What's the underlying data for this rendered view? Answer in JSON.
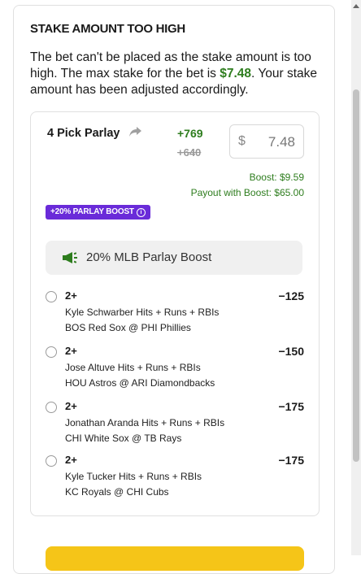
{
  "alert": {
    "title": "STAKE AMOUNT TOO HIGH",
    "message_before": "The bet can't be placed as the stake amount is too high. The max stake for the bet is ",
    "max_stake": "$7.48",
    "message_after": ". Your stake amount has been adjusted accordingly."
  },
  "bet": {
    "title": "4 Pick Parlay",
    "odds_boosted": "+769",
    "odds_original": "+640",
    "stake_currency": "$",
    "stake_value": "7.48",
    "boost_amount": "Boost: $9.59",
    "payout": "Payout with Boost: $65.00",
    "badge": "+20% PARLAY BOOST",
    "promo": "20% MLB Parlay Boost"
  },
  "legs": [
    {
      "line": "2+",
      "odds": "−125",
      "player": "Kyle Schwarber Hits + Runs + RBIs",
      "game": "BOS Red Sox @ PHI Phillies"
    },
    {
      "line": "2+",
      "odds": "−150",
      "player": "Jose Altuve Hits + Runs + RBIs",
      "game": "HOU Astros @ ARI Diamondbacks"
    },
    {
      "line": "2+",
      "odds": "−175",
      "player": "Jonathan Aranda Hits + Runs + RBIs",
      "game": "CHI White Sox @ TB Rays"
    },
    {
      "line": "2+",
      "odds": "−175",
      "player": "Kyle Tucker Hits + Runs + RBIs",
      "game": "KC Royals @ CHI Cubs"
    }
  ],
  "colors": {
    "accent_green": "#2e7d1e",
    "badge_purple": "#6a2bd9",
    "button_yellow": "#f5c518"
  },
  "icons": [
    "share-icon",
    "info-icon",
    "megaphone-icon",
    "scroll-up-arrow-icon"
  ]
}
